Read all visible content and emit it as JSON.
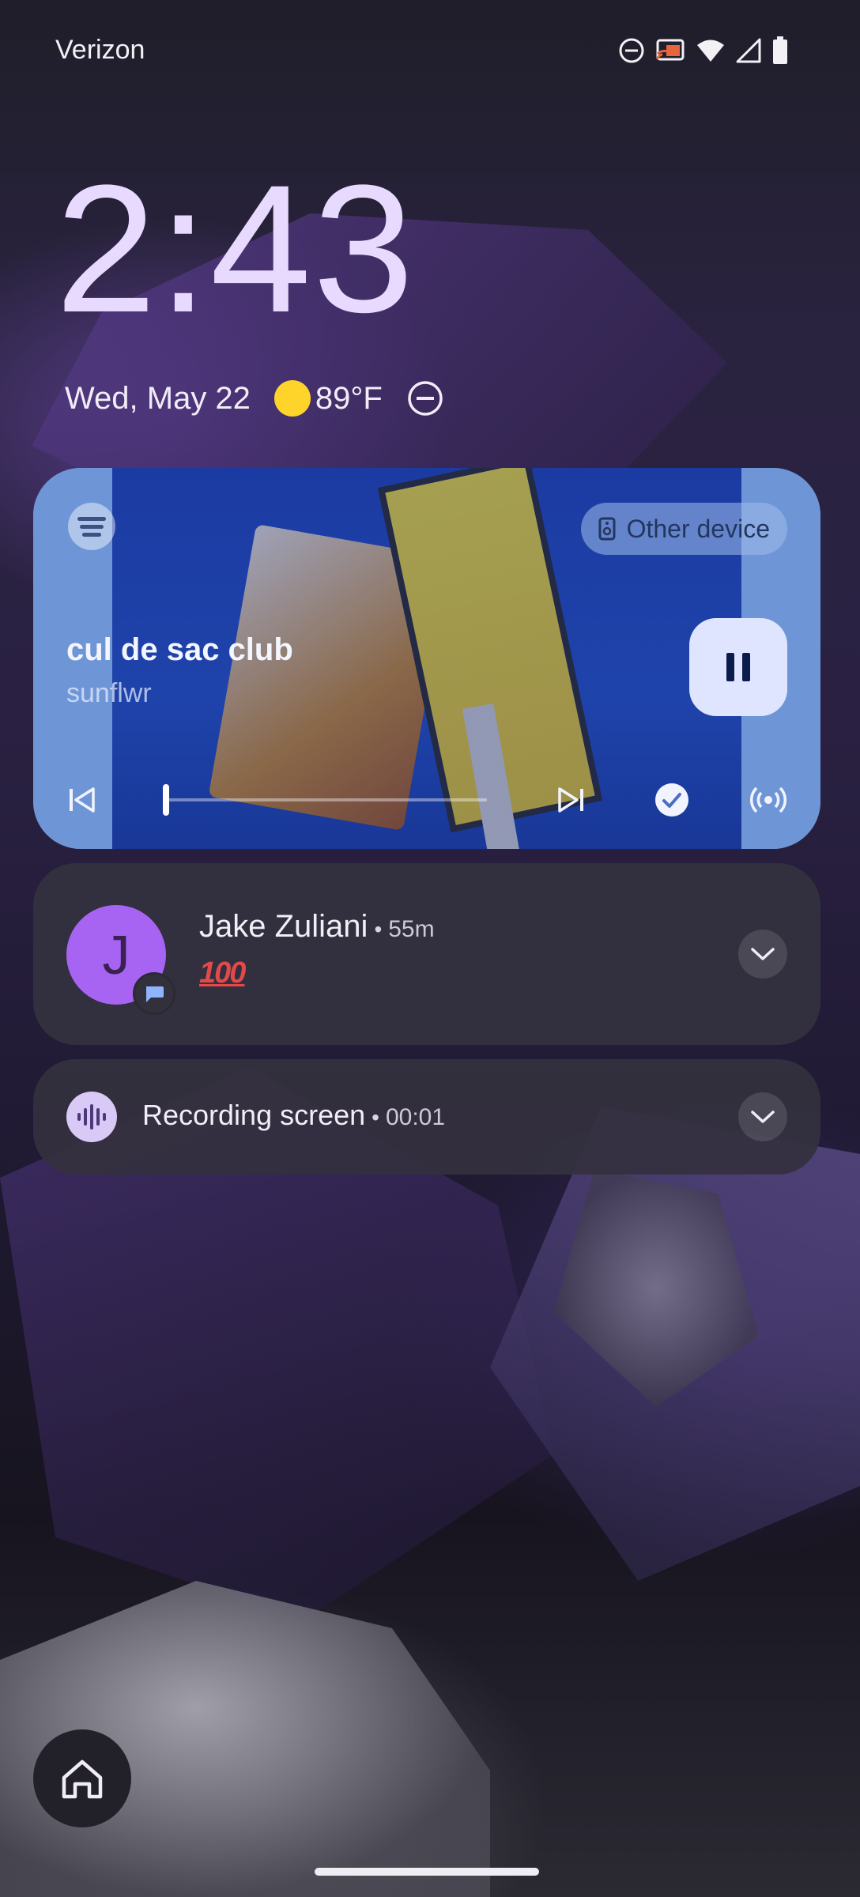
{
  "status_bar": {
    "carrier": "Verizon",
    "icons": [
      "do-not-disturb-icon",
      "cast-icon",
      "wifi-icon",
      "cell-signal-icon",
      "battery-icon"
    ]
  },
  "lockscreen": {
    "time": "2:43",
    "date": "Wed, May 22",
    "weather_temp": "89°F",
    "weather_icon": "sun-icon",
    "weather_color": "#ffd42a"
  },
  "media": {
    "app_icon": "spotify-icon",
    "output_device_label": "Other device",
    "song_title": "cul de sac club",
    "artist": "sunflwr",
    "progress_fraction": 0.0,
    "controls": [
      "previous-icon",
      "pause-icon",
      "next-icon",
      "check-icon",
      "cast-broadcast-icon"
    ],
    "card_color": "#6f96d6",
    "pause_button_color": "#dfe4ff"
  },
  "notifications": [
    {
      "sender": "Jake Zuliani",
      "time": "55m",
      "avatar_letter": "J",
      "avatar_color": "#a763f2",
      "content": "100"
    },
    {
      "title": "Recording screen",
      "elapsed": "00:01"
    }
  ],
  "separator": "•"
}
